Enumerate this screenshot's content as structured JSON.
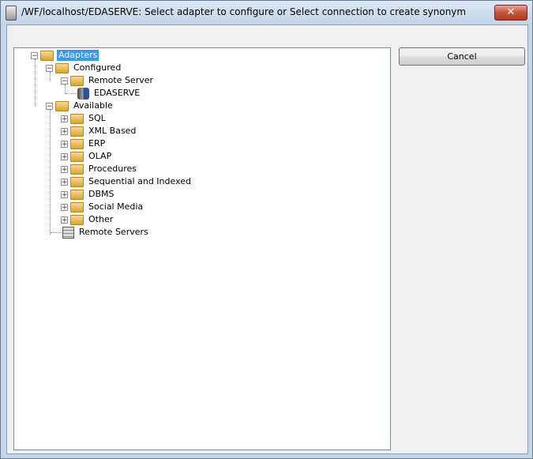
{
  "window": {
    "title": "/WF/localhost/EDASERVE: Select adapter to configure or Select connection to create synonym",
    "close_label": "✕"
  },
  "buttons": {
    "cancel": "Cancel"
  },
  "tree": {
    "root": "Adapters",
    "configured": "Configured",
    "remote_server": "Remote Server",
    "edaserve": "EDASERVE",
    "available": "Available",
    "available_items": [
      "SQL",
      "XML Based",
      "ERP",
      "OLAP",
      "Procedures",
      "Sequential and Indexed",
      "DBMS",
      "Social Media",
      "Other"
    ],
    "remote_servers": "Remote Servers"
  }
}
